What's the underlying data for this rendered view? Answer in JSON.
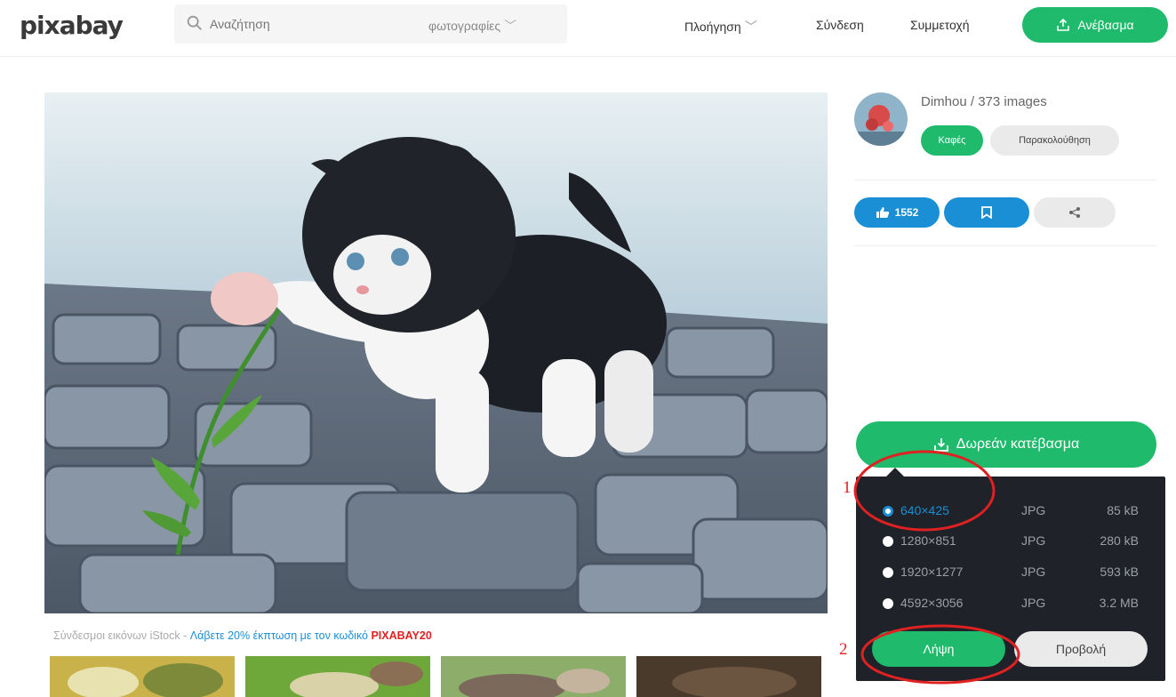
{
  "header": {
    "logo": "pixabay",
    "search_placeholder": "Αναζήτηση",
    "search_type": "φωτογραφίες",
    "explore": "Πλοήγηση",
    "login": "Σύνδεση",
    "join": "Συμμετοχή",
    "upload": "Ανέβασμα"
  },
  "author": {
    "name_line": "Dimhou / 373 images",
    "coffee": "Καφές",
    "follow": "Παρακολούθηση"
  },
  "actions": {
    "likes": "1552"
  },
  "download": {
    "button": "Δωρεάν κατέβασμα",
    "options": [
      {
        "size": "640×425",
        "format": "JPG",
        "filesize": "85 kB",
        "selected": true
      },
      {
        "size": "1280×851",
        "format": "JPG",
        "filesize": "280 kB",
        "selected": false
      },
      {
        "size": "1920×1277",
        "format": "JPG",
        "filesize": "593 kB",
        "selected": false
      },
      {
        "size": "4592×3056",
        "format": "JPG",
        "filesize": "3.2 MB",
        "selected": false
      }
    ],
    "get": "Λήψη",
    "view": "Προβολή"
  },
  "istock": {
    "prefix": "Σύνδεσμοι εικόνων iStock - ",
    "promo": "Λάβετε 20% έκπτωση με τον κωδικό ",
    "code": "PIXABAY20"
  },
  "annotations": {
    "one": "1",
    "two": "2"
  },
  "colors": {
    "green": "#1fba6b",
    "blue": "#1a8fd6",
    "annotation_red": "#e02121",
    "panel_bg": "#1f2229"
  }
}
